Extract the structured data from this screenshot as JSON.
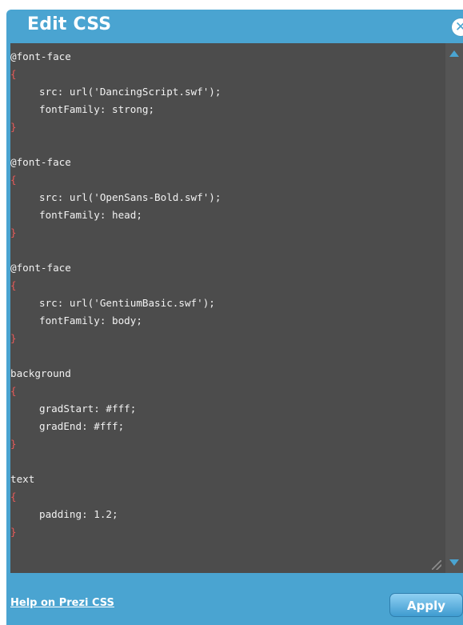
{
  "dialog": {
    "title": "Edit CSS",
    "close_glyph": "✕",
    "close_icon": "close-icon",
    "accent_color": "#4aa4d1",
    "editor_background": "#4c4c4c",
    "brace_color": "#e85a5a"
  },
  "editor": {
    "lines": [
      "@font-face",
      "{",
      "src: url('DancingScript.swf');",
      "fontFamily: strong;",
      "}",
      "",
      "@font-face",
      "{",
      "src: url('OpenSans-Bold.swf');",
      "fontFamily: head;",
      "}",
      "",
      "@font-face",
      "{",
      "src: url('GentiumBasic.swf');",
      "fontFamily: body;",
      "}",
      "",
      "background",
      "{",
      "gradStart: #fff;",
      "gradEnd: #fff;",
      "}",
      "",
      "text",
      "{",
      "padding: 1.2;",
      "}"
    ]
  },
  "footer": {
    "help_label": "Help on Prezi CSS",
    "apply_label": "Apply"
  }
}
